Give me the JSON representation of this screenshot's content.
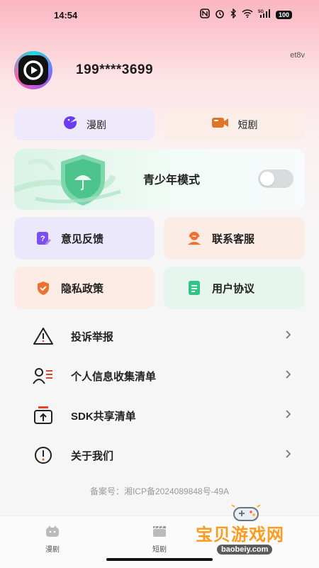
{
  "status_bar": {
    "time": "14:54",
    "signal_label": "5G",
    "battery": "100"
  },
  "profile": {
    "id_code": "et8v",
    "phone": "199****3699"
  },
  "tabs": [
    {
      "label": "漫剧",
      "color": "#6a3df0"
    },
    {
      "label": "短剧",
      "color": "#e0742a"
    }
  ],
  "teen_mode": {
    "label": "青少年模式",
    "enabled": false
  },
  "features": [
    {
      "label": "意见反馈",
      "icon": "feedback-icon",
      "color": "#7b4ff2"
    },
    {
      "label": "联系客服",
      "icon": "customer-service-icon",
      "color": "#f0712f"
    },
    {
      "label": "隐私政策",
      "icon": "shield-icon",
      "color": "#f0712f"
    },
    {
      "label": "用户协议",
      "icon": "document-icon",
      "color": "#2fc585"
    }
  ],
  "menu": [
    {
      "label": "投诉举报",
      "icon": "warning-icon"
    },
    {
      "label": "个人信息收集清单",
      "icon": "user-list-icon"
    },
    {
      "label": "SDK共享清单",
      "icon": "share-box-icon"
    },
    {
      "label": "关于我们",
      "icon": "info-icon"
    }
  ],
  "icp": "备案号：湘ICP备2024089848号-49A",
  "bottom_nav": [
    {
      "label": "漫剧",
      "icon": "manhua-icon"
    },
    {
      "label": "短剧",
      "icon": "clapper-icon"
    }
  ],
  "watermark": {
    "title": "宝贝游戏网",
    "url": "baobeiy.com"
  }
}
